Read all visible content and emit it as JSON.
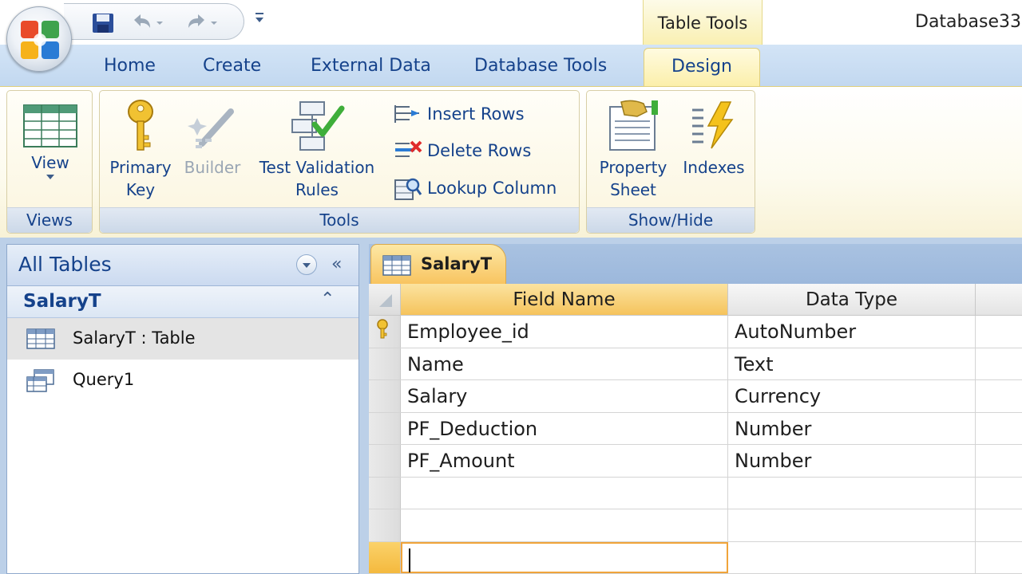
{
  "title_bar": {
    "context_tab": "Table Tools",
    "document_title": "Database33"
  },
  "tabs": [
    {
      "label": "Home"
    },
    {
      "label": "Create"
    },
    {
      "label": "External Data"
    },
    {
      "label": "Database Tools"
    },
    {
      "label": "Design"
    }
  ],
  "ribbon": {
    "views": {
      "label": "Views",
      "view_button": "View"
    },
    "tools": {
      "label": "Tools",
      "primary_key": [
        "Primary",
        "Key"
      ],
      "builder": "Builder",
      "test_validation": [
        "Test Validation",
        "Rules"
      ],
      "insert_rows": "Insert Rows",
      "delete_rows": "Delete Rows",
      "lookup_column": "Lookup Column"
    },
    "show_hide": {
      "label": "Show/Hide",
      "property_sheet": [
        "Property",
        "Sheet"
      ],
      "indexes": "Indexes"
    }
  },
  "nav_pane": {
    "title": "All Tables",
    "group": "SalaryT",
    "items": [
      {
        "label": "SalaryT : Table",
        "icon": "table-icon"
      },
      {
        "label": "Query1",
        "icon": "query-icon"
      }
    ]
  },
  "document": {
    "tab_label": "SalaryT",
    "columns": [
      "Field Name",
      "Data Type"
    ],
    "rows": [
      {
        "field": "Employee_id",
        "type": "AutoNumber",
        "primary_key": true
      },
      {
        "field": "Name",
        "type": "Text"
      },
      {
        "field": "Salary",
        "type": "Currency"
      },
      {
        "field": "PF_Deduction",
        "type": "Number"
      },
      {
        "field": "PF_Amount",
        "type": "Number"
      }
    ]
  },
  "colors": {
    "ribbon_text": "#15428b",
    "context_yellow": "#f8c460",
    "pane_blue": "#bcd0e8"
  }
}
